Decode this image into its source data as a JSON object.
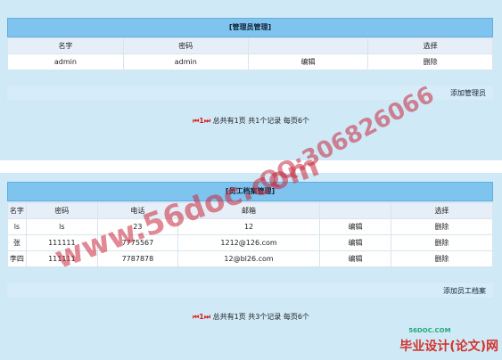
{
  "admin_panel": {
    "title": "[管理员管理]",
    "headers": [
      "名字",
      "密码",
      "",
      "选择"
    ],
    "rows": [
      {
        "name": "admin",
        "password": "admin",
        "edit": "编辑",
        "delete": "删除"
      }
    ],
    "add_link": "添加管理员",
    "pager": {
      "first": "⏮1⏭",
      "text": "总共有1页 共1个记录 每页6个"
    }
  },
  "employee_panel": {
    "title": "[员工档案管理]",
    "headers": [
      "名字",
      "密码",
      "电话",
      "邮箱",
      "",
      "选择"
    ],
    "rows": [
      {
        "name": "ls",
        "password": "ls",
        "phone": "23",
        "email": "12",
        "edit": "编辑",
        "delete": "删除"
      },
      {
        "name": "张",
        "password": "111111",
        "phone": "7775567",
        "email": "1212@126.com",
        "edit": "编辑",
        "delete": "删除"
      },
      {
        "name": "李四",
        "password": "111111",
        "phone": "7787878",
        "email": "12@bl26.com",
        "edit": "编辑",
        "delete": "删除"
      }
    ],
    "add_link": "添加员工档案",
    "pager": {
      "first": "⏮1⏭",
      "text": "总共有1页 共3个记录 每页6个"
    }
  },
  "watermarks": {
    "site": "www.56doc.com",
    "qq": "QQ:306826066",
    "brand_small": "56DOC.COM",
    "brand": "毕业设计(论文)网"
  }
}
